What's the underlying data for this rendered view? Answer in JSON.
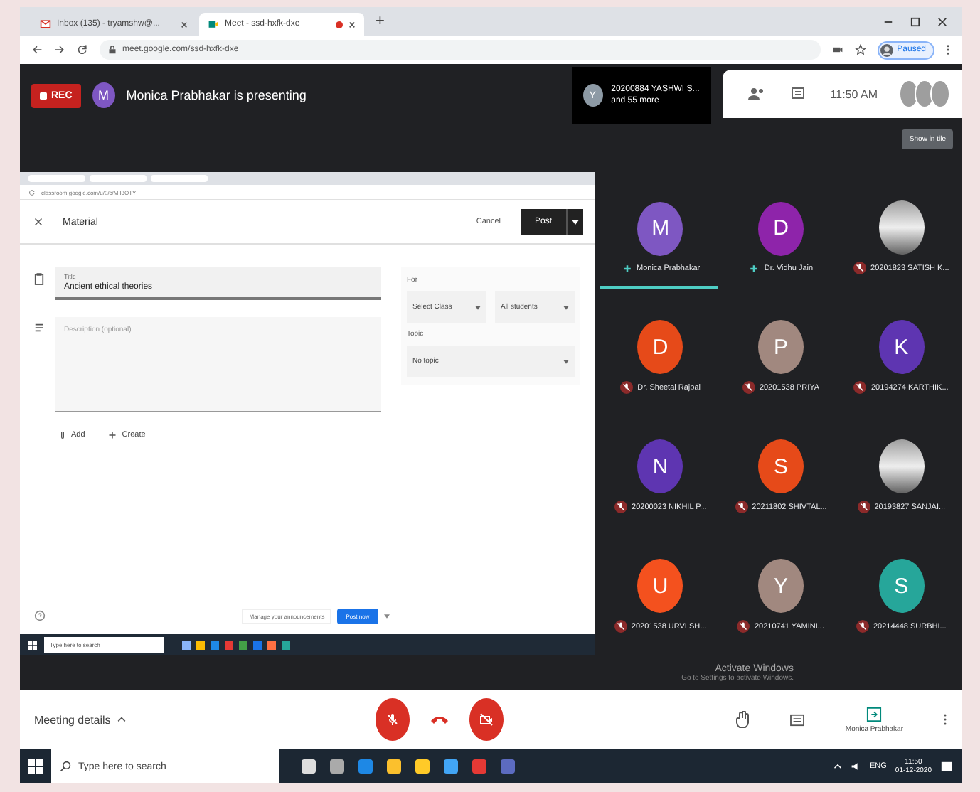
{
  "browser": {
    "tabs": [
      {
        "label": "Inbox (135) - tryamshw@...",
        "selected": false
      },
      {
        "label": "Meet - ssd-hxfk-dxe",
        "selected": true
      }
    ],
    "new_tab": "+",
    "url": "meet.google.com/ssd-hxfk-dxe",
    "profile": "Paused"
  },
  "meet": {
    "rec": "REC",
    "presenter_initial": "M",
    "presenting_text": "Monica Prabhakar is presenting",
    "participants": {
      "initial": "Y",
      "lines": [
        "20200884 YASHWI S...",
        "and 55 more"
      ]
    },
    "time": "11:50 AM",
    "show_button": "Show in tile",
    "shared_screen": {
      "url": "classroom.google.com/u/0/c/MjI3OTY",
      "header": {
        "title": "Material",
        "cancel": "Cancel",
        "post": "Post"
      },
      "title_field": {
        "label": "Title",
        "value": "Ancient ethical theories"
      },
      "description": {
        "placeholder": "Description (optional)"
      },
      "actions": [
        "Add",
        "Create"
      ],
      "for_label": "For",
      "class_select": "Select Class",
      "students_select": "All students",
      "topic_label": "Topic",
      "topic_select": "No topic",
      "notice": "Manage your announcements",
      "notice_button": "Post now",
      "taskbar_search": "Type here to search"
    },
    "tiles": [
      {
        "kind": "letter",
        "initial": "M",
        "name": "Monica Prabhakar",
        "color": "#7e57c2",
        "muted": false,
        "presenting": true
      },
      {
        "kind": "letter",
        "initial": "D",
        "name": "Dr. Vidhu Jain",
        "color": "#8e24aa",
        "muted": false,
        "presenting": false
      },
      {
        "kind": "photo",
        "name": "20201823 SATISH K...",
        "muted": true,
        "presenting": false
      },
      {
        "kind": "letter",
        "initial": "D",
        "name": "Dr. Sheetal Rajpal",
        "color": "#e64a19",
        "muted": true,
        "presenting": false
      },
      {
        "kind": "letter",
        "initial": "P",
        "name": "20201538 PRIYA",
        "color": "#a1887f",
        "muted": true,
        "presenting": false
      },
      {
        "kind": "letter",
        "initial": "K",
        "name": "20194274 KARTHIK...",
        "color": "#5e35b1",
        "muted": true,
        "presenting": false
      },
      {
        "kind": "letter",
        "initial": "N",
        "name": "20200023 NIKHIL P...",
        "color": "#5e35b1",
        "muted": true,
        "presenting": false
      },
      {
        "kind": "letter",
        "initial": "S",
        "name": "20211802 SHIVTAL...",
        "color": "#e64a19",
        "muted": true,
        "presenting": false
      },
      {
        "kind": "photo",
        "name": "20193827 SANJAI...",
        "muted": true,
        "presenting": false
      },
      {
        "kind": "letter",
        "initial": "U",
        "name": "20201538 URVI SH...",
        "color": "#f4511e",
        "muted": true,
        "presenting": false
      },
      {
        "kind": "letter",
        "initial": "Y",
        "name": "20210741 YAMINI...",
        "color": "#a1887f",
        "muted": true,
        "presenting": false
      },
      {
        "kind": "letter",
        "initial": "S",
        "name": "20214448 SURBHI...",
        "color": "#26a69a",
        "muted": true,
        "presenting": false
      }
    ],
    "activate": [
      "Activate Windows",
      "Go to Settings to activate Windows."
    ],
    "controls": {
      "meeting_details": "Meeting details",
      "mic_off": true,
      "camera_off": true,
      "present_label": "Monica Prabhakar"
    }
  },
  "taskbar": {
    "search": "Type here to search",
    "lang": "ENG",
    "time": "11:50",
    "date": "01-12-2020"
  }
}
